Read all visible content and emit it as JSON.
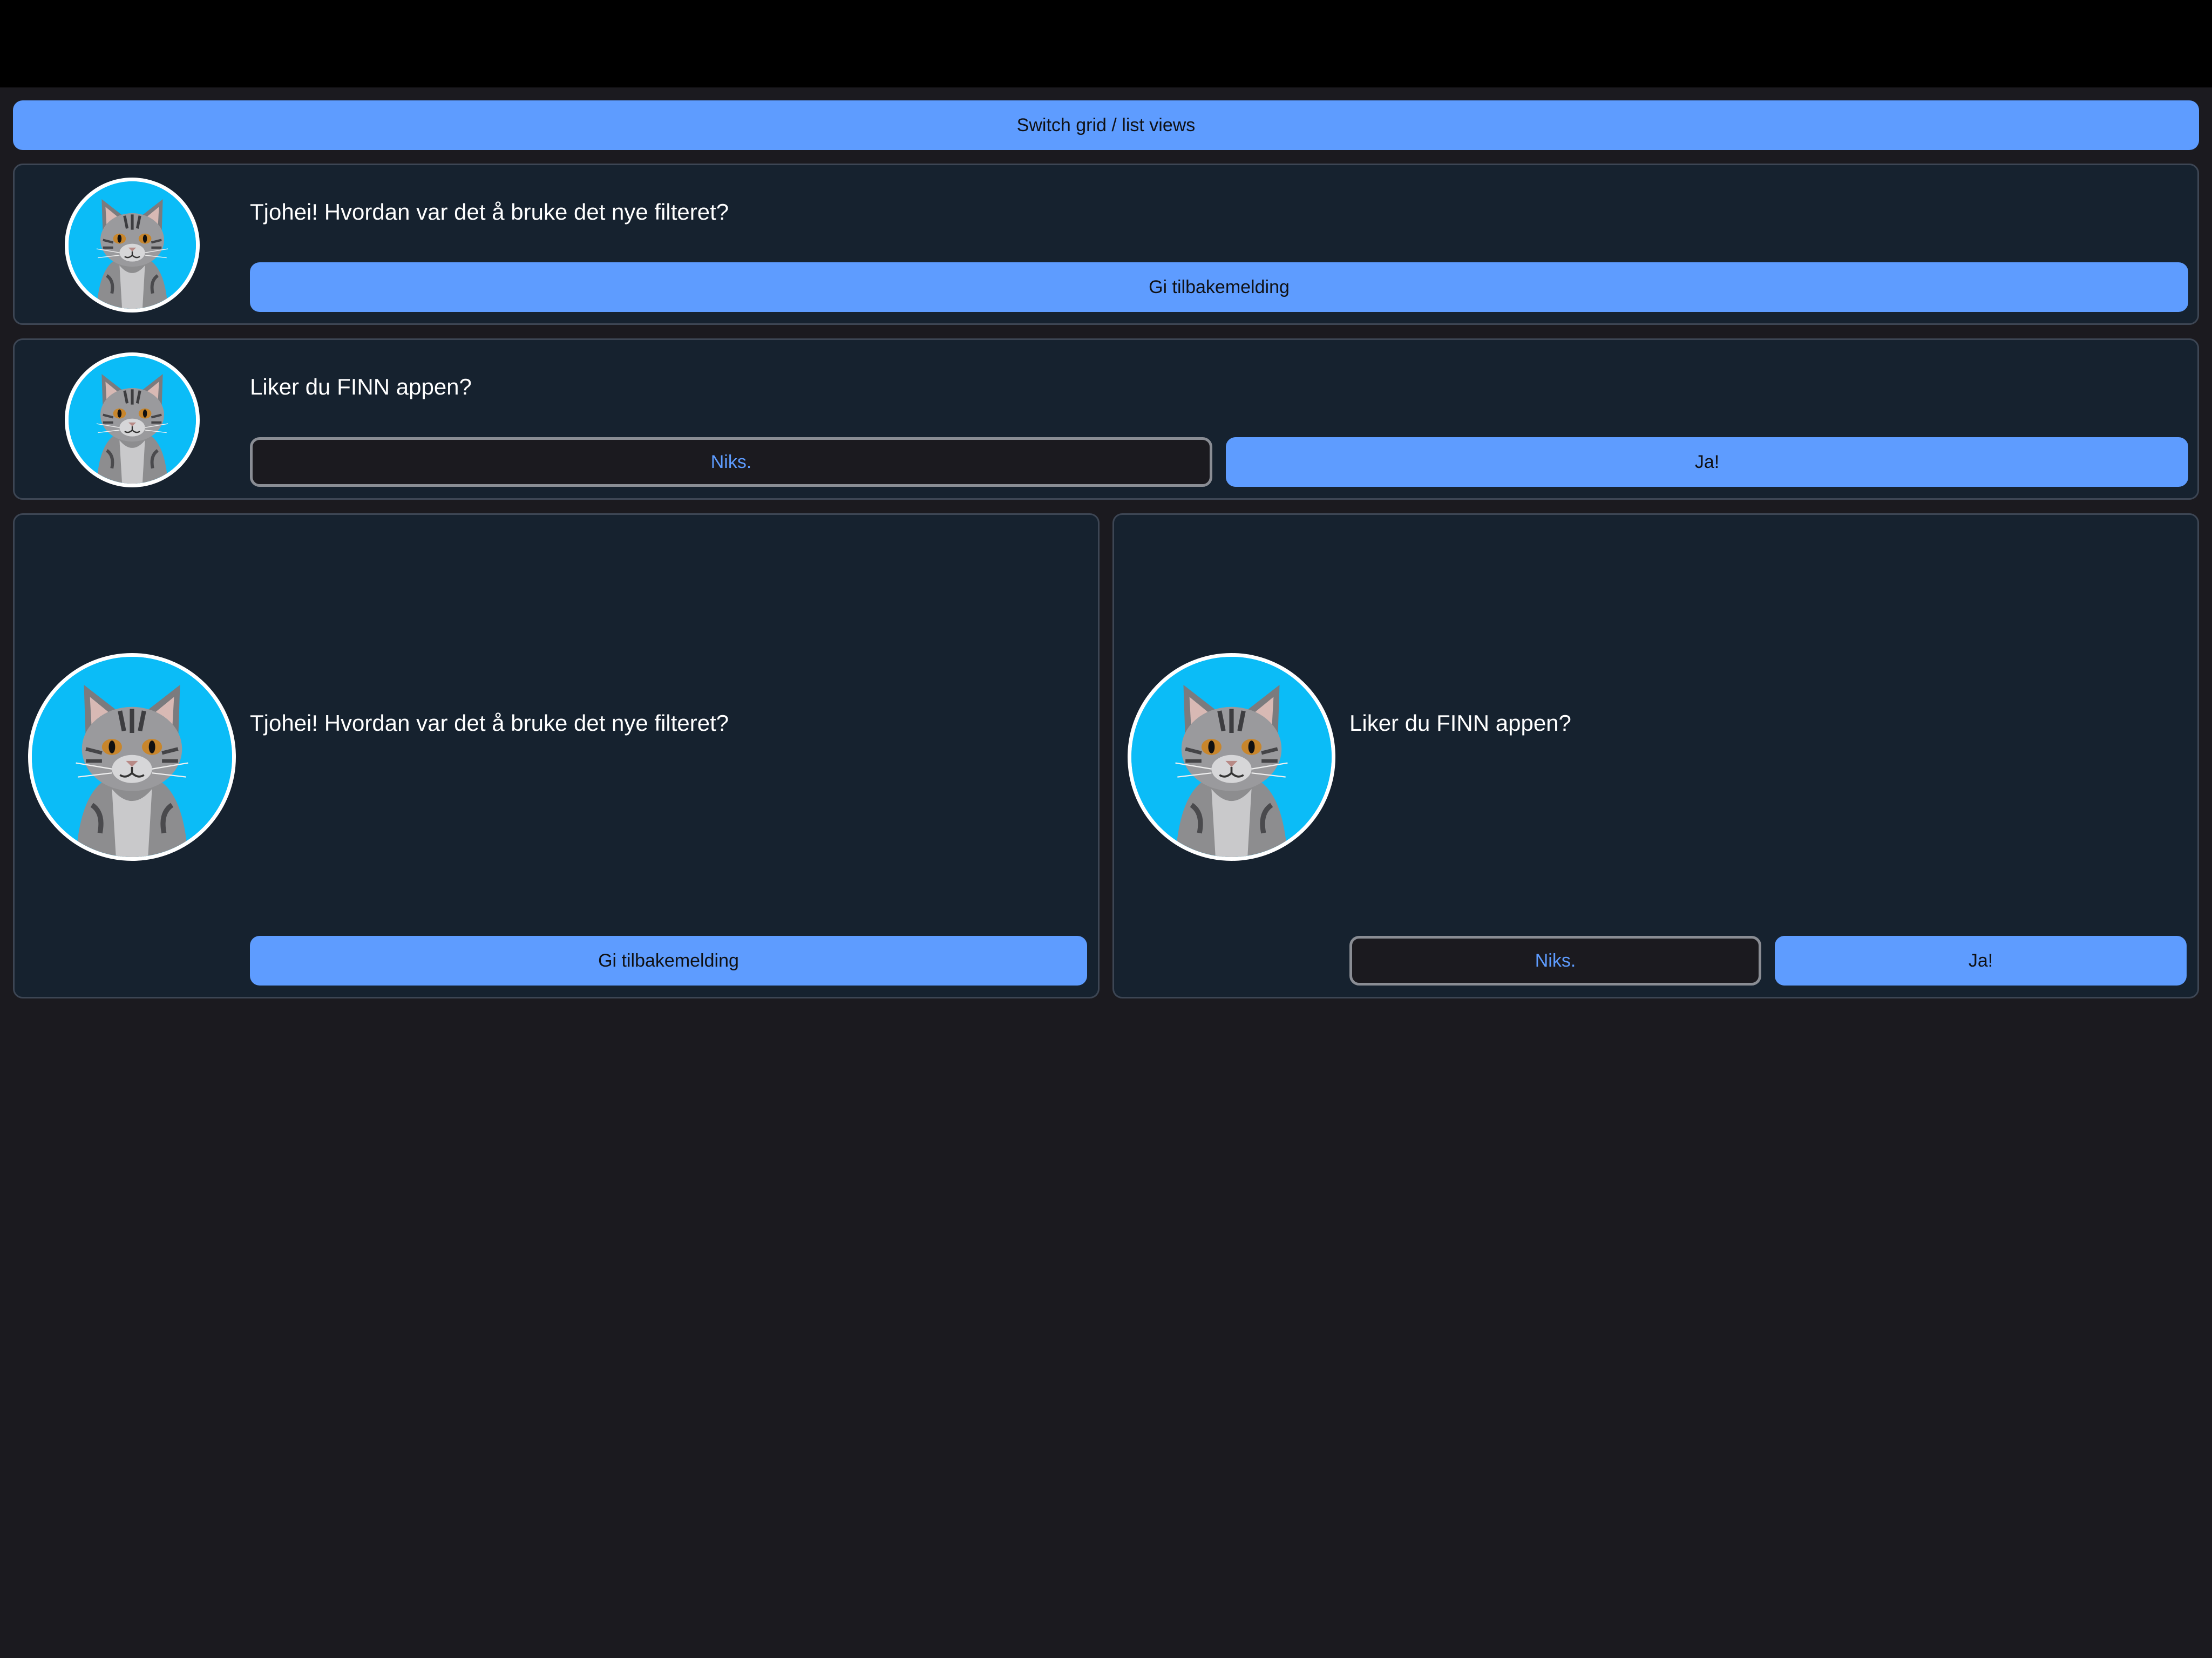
{
  "toolbar": {
    "switch_label": "Switch grid / list views"
  },
  "list_cards": [
    {
      "message": "Tjohei! Hvordan var det å bruke det nye filteret?",
      "primary_label": "Gi tilbakemelding"
    },
    {
      "message": "Liker du FINN appen?",
      "secondary_label": "Niks.",
      "primary_label": "Ja!"
    }
  ],
  "grid_cards": [
    {
      "message": "Tjohei! Hvordan var det å bruke det nye filteret?",
      "primary_label": "Gi tilbakemelding"
    },
    {
      "message": "Liker du FINN appen?",
      "secondary_label": "Niks.",
      "primary_label": "Ja!"
    }
  ],
  "avatar_icon": "cat-avatar-icon",
  "colors": {
    "accent": "#5e9cff",
    "card_bg": "#16222f",
    "page_bg": "#1b1a1f",
    "avatar_bg": "#0bbcf7"
  }
}
